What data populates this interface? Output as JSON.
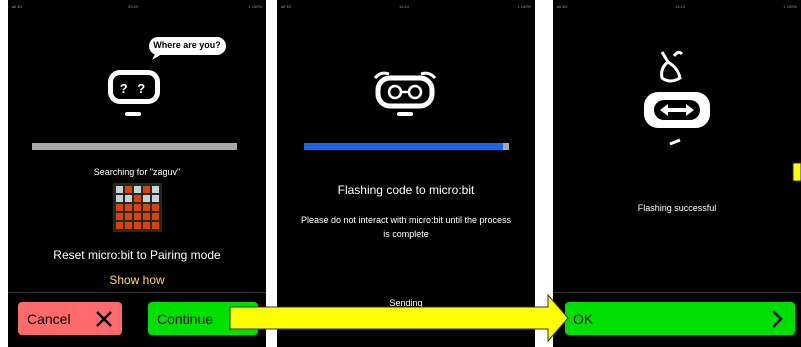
{
  "colors": {
    "accent_blue": "#1a66e6",
    "green": "#00e000",
    "red": "#ff6b6b",
    "yellow": "#ffff00",
    "gray": "#a8a8a8",
    "gold": "#ffd75e",
    "led_on": "#e04000",
    "led_off": "#c8d0d8"
  },
  "panel1": {
    "status_left": "ail 3G",
    "status_time": "23:49",
    "status_right": "1 100%",
    "bubble": "Where are you?",
    "robot_eyes": "? ?",
    "searching": "Searching for \"zaguv\"",
    "led_pattern": [
      [
        0,
        1,
        0,
        1,
        0
      ],
      [
        0,
        0,
        1,
        0,
        0
      ],
      [
        1,
        1,
        1,
        1,
        1
      ],
      [
        1,
        1,
        1,
        1,
        1
      ],
      [
        1,
        1,
        1,
        1,
        1
      ]
    ],
    "reset": "Reset micro:bit to Pairing mode",
    "show_how": "Show how",
    "cancel": "Cancel",
    "continue": "Continue",
    "icons": {
      "cancel": "close-icon",
      "continue": "chevron-right-icon"
    }
  },
  "panel2": {
    "status_left": "all 3G",
    "status_time": "13:14",
    "status_right": "1 100%",
    "progress": 0.97,
    "title": "Flashing code to micro:bit",
    "note": "Please do not interact with micro:bit until the process is complete",
    "sending": "Sending"
  },
  "panel3": {
    "status_left": "all 3G",
    "status_time": "13:14",
    "status_right": "1 100%",
    "message": "Flashing successful",
    "ok": "OK",
    "icons": {
      "ok": "chevron-right-icon"
    }
  }
}
